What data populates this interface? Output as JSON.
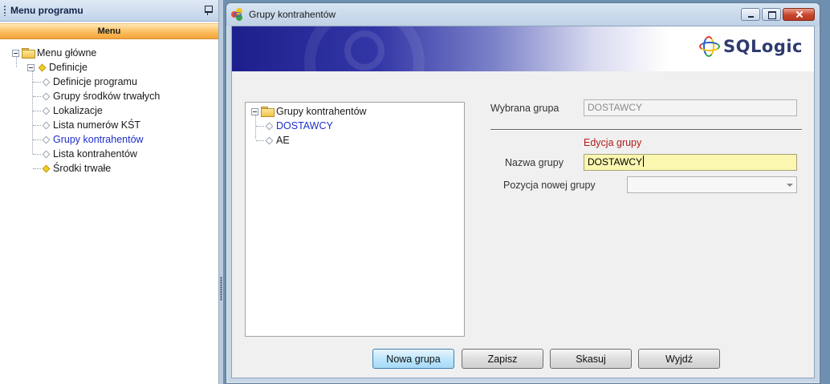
{
  "left_panel": {
    "title": "Menu programu",
    "band_label": "Menu",
    "tree": {
      "root": "Menu główne",
      "definicje": "Definicje",
      "children": [
        "Definicje programu",
        "Grupy środków trwałych",
        "Lokalizacje",
        "Lista numerów KŚT",
        "Grupy kontrahentów",
        "Lista kontrahentów"
      ],
      "srodki": "Środki trwałe",
      "active_index": 4
    }
  },
  "dialog": {
    "title": "Grupy kontrahentów",
    "logo_text": "SQLogic",
    "group_tree": {
      "root": "Grupy kontrahentów",
      "items": [
        "DOSTAWCY",
        "AE"
      ]
    },
    "selected_group_label": "Wybrana grupa",
    "selected_group_value": "DOSTAWCY",
    "edit_section_title": "Edycja grupy",
    "name_label": "Nazwa grupy",
    "name_value": "DOSTAWCY",
    "position_label": "Pozycja nowej grupy",
    "position_value": "",
    "buttons": {
      "new_group": "Nowa grupa",
      "save": "Zapisz",
      "delete": "Skasuj",
      "exit": "Wyjdź"
    }
  },
  "colors": {
    "active_item": "#1d2ecc",
    "section_title": "#b01c1c",
    "menu_band": "#fbbf5f",
    "edit_field": "#fbf6b0"
  }
}
